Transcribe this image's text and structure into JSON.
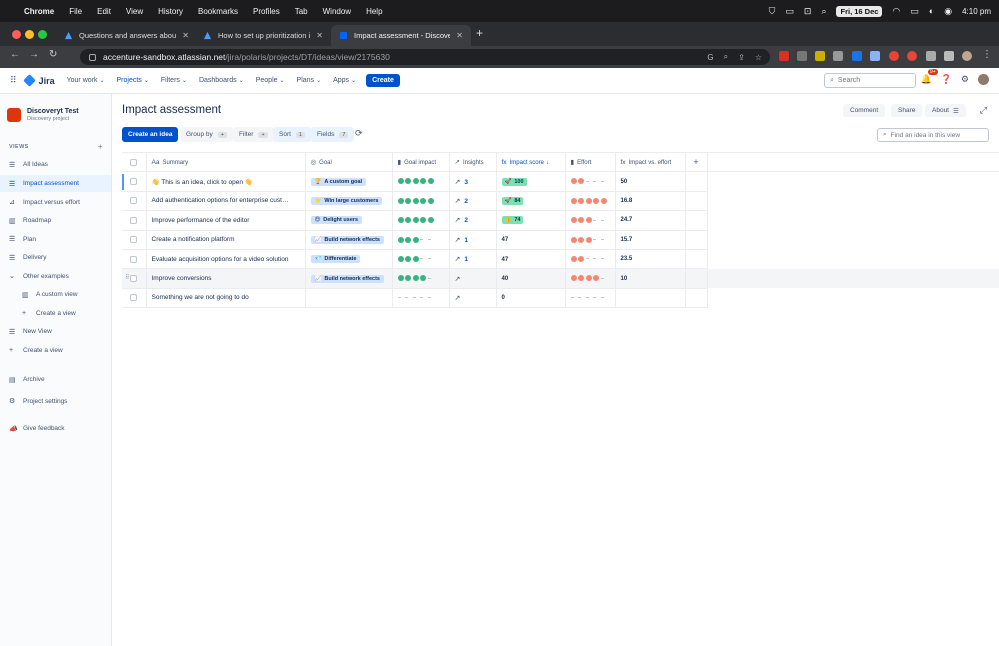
{
  "mac_menu": {
    "app": "Chrome",
    "items": [
      "File",
      "Edit",
      "View",
      "History",
      "Bookmarks",
      "Profiles",
      "Tab",
      "Window",
      "Help"
    ],
    "date": "Fri, 16 Dec",
    "time": "4:10 pm"
  },
  "browser": {
    "tabs": [
      {
        "title": "Questions and answers about",
        "active": false
      },
      {
        "title": "How to set up prioritization in",
        "active": false
      },
      {
        "title": "Impact assessment - Discover",
        "active": true
      }
    ],
    "url_host": "accenture-sandbox.atlassian.net",
    "url_path": "/jira/polaris/projects/DT/ideas/view/2175630"
  },
  "topnav": {
    "product": "Jira",
    "items": [
      {
        "label": "Your work",
        "active": false
      },
      {
        "label": "Projects",
        "active": true
      },
      {
        "label": "Filters",
        "active": false
      },
      {
        "label": "Dashboards",
        "active": false
      },
      {
        "label": "People",
        "active": false
      },
      {
        "label": "Plans",
        "active": false
      },
      {
        "label": "Apps",
        "active": false
      }
    ],
    "create_label": "Create",
    "search_placeholder": "Search",
    "notification_count": "9+"
  },
  "sidebar": {
    "project_name": "Discoveryt Test",
    "project_type": "Discovery project",
    "views_header": "VIEWS",
    "items": [
      {
        "label": "All Ideas",
        "icon": "list-icon",
        "glyph": "☰",
        "active": false,
        "sub": false
      },
      {
        "label": "Impact assessment",
        "icon": "list-icon",
        "glyph": "☰",
        "active": true,
        "sub": false
      },
      {
        "label": "Impact versus effort",
        "icon": "matrix-icon",
        "glyph": "⊿",
        "active": false,
        "sub": false
      },
      {
        "label": "Roadmap",
        "icon": "board-icon",
        "glyph": "▥",
        "active": false,
        "sub": false
      },
      {
        "label": "Plan",
        "icon": "list-icon",
        "glyph": "☰",
        "active": false,
        "sub": false
      },
      {
        "label": "Delivery",
        "icon": "list-icon",
        "glyph": "☰",
        "active": false,
        "sub": false
      },
      {
        "label": "Other examples",
        "icon": "chevron-down-icon",
        "glyph": "⌄",
        "active": false,
        "sub": false
      },
      {
        "label": "A custom view",
        "icon": "board-icon",
        "glyph": "▥",
        "active": false,
        "sub": true
      },
      {
        "label": "Create a view",
        "icon": "plus-icon",
        "glyph": "+",
        "active": false,
        "sub": true
      },
      {
        "label": "New View",
        "icon": "list-icon",
        "glyph": "☰",
        "active": false,
        "sub": false
      },
      {
        "label": "Create a view",
        "icon": "plus-icon",
        "glyph": "+",
        "active": false,
        "sub": false
      }
    ],
    "footer_items": [
      {
        "label": "Archive",
        "icon": "archive-icon",
        "glyph": "▤"
      },
      {
        "label": "Project settings",
        "icon": "gear-icon",
        "glyph": "⚙"
      },
      {
        "label": "Give feedback",
        "icon": "megaphone-icon",
        "glyph": "📣"
      }
    ]
  },
  "main": {
    "title": "Impact assessment",
    "header_buttons": [
      "Comment",
      "Share",
      "About"
    ],
    "create_idea_label": "Create an idea",
    "controls": [
      {
        "label": "Group by",
        "count": "+"
      },
      {
        "label": "Filter",
        "count": "+"
      },
      {
        "label": "Sort",
        "count": "1"
      },
      {
        "label": "Fields",
        "count": "7"
      }
    ],
    "search_placeholder": "Find an idea in this view"
  },
  "table": {
    "columns": [
      {
        "label": "Summary",
        "icon": "text-field-icon",
        "glyph": "Aa",
        "sorted": false
      },
      {
        "label": "Goal",
        "icon": "goal-icon",
        "glyph": "◎",
        "sorted": false
      },
      {
        "label": "Goal impact",
        "icon": "bar-chart-icon",
        "glyph": "▮",
        "sorted": false
      },
      {
        "label": "Insights",
        "icon": "trend-icon",
        "glyph": "↗",
        "sorted": false
      },
      {
        "label": "Impact score",
        "icon": "formula-icon",
        "glyph": "fx",
        "sorted": true
      },
      {
        "label": "Effort",
        "icon": "bar-chart-icon",
        "glyph": "▮",
        "sorted": false
      },
      {
        "label": "Impact vs. effort",
        "icon": "formula-icon",
        "glyph": "fx",
        "sorted": false
      }
    ],
    "sort_arrow": "↓",
    "colors": {
      "goal_dot": "#36b37e",
      "effort_dot": "#f48771",
      "goal_pill_bg": "#cce0ff",
      "score_pill_bg": "#79e2b2"
    },
    "rows": [
      {
        "summary": "👋 This is an idea, click to open 👋",
        "goal": "A custom goal",
        "goal_icon": "🏆",
        "goal_impact": 5,
        "insights": "3",
        "score": "100",
        "score_icon": "🚀",
        "effort": 2,
        "ive": "50",
        "lead": true
      },
      {
        "summary": "Add authentication options for enterprise cust…",
        "goal": "Win large customers",
        "goal_icon": "⭐",
        "goal_impact": 5,
        "insights": "2",
        "score": "84",
        "score_icon": "🚀",
        "effort": 5,
        "ive": "16.8"
      },
      {
        "summary": "Improve performance of the editor",
        "goal": "Delight users",
        "goal_icon": "😍",
        "goal_impact": 5,
        "insights": "2",
        "score": "74",
        "score_icon": "👍",
        "effort": 3,
        "ive": "24.7"
      },
      {
        "summary": "Create a notification platform",
        "goal": "Build network effects",
        "goal_icon": "📈",
        "goal_impact": 3,
        "insights": "1",
        "score": "47",
        "score_icon": "",
        "effort": 3,
        "ive": "15.7"
      },
      {
        "summary": "Evaluate acquisition options for a video solution",
        "goal": "Differentiate",
        "goal_icon": "💎",
        "goal_impact": 3,
        "insights": "1",
        "score": "47",
        "score_icon": "",
        "effort": 2,
        "ive": "23.5"
      },
      {
        "summary": "Improve conversions",
        "goal": "Build network effects",
        "goal_icon": "📈",
        "goal_impact": 4,
        "insights": "",
        "score": "40",
        "score_icon": "",
        "effort": 4,
        "ive": "10",
        "hovered": true
      },
      {
        "summary": "Something we are not going to do",
        "goal": "",
        "goal_icon": "",
        "goal_impact": 0,
        "insights": "",
        "score": "0",
        "score_icon": "",
        "effort": 0,
        "ive": ""
      }
    ]
  }
}
